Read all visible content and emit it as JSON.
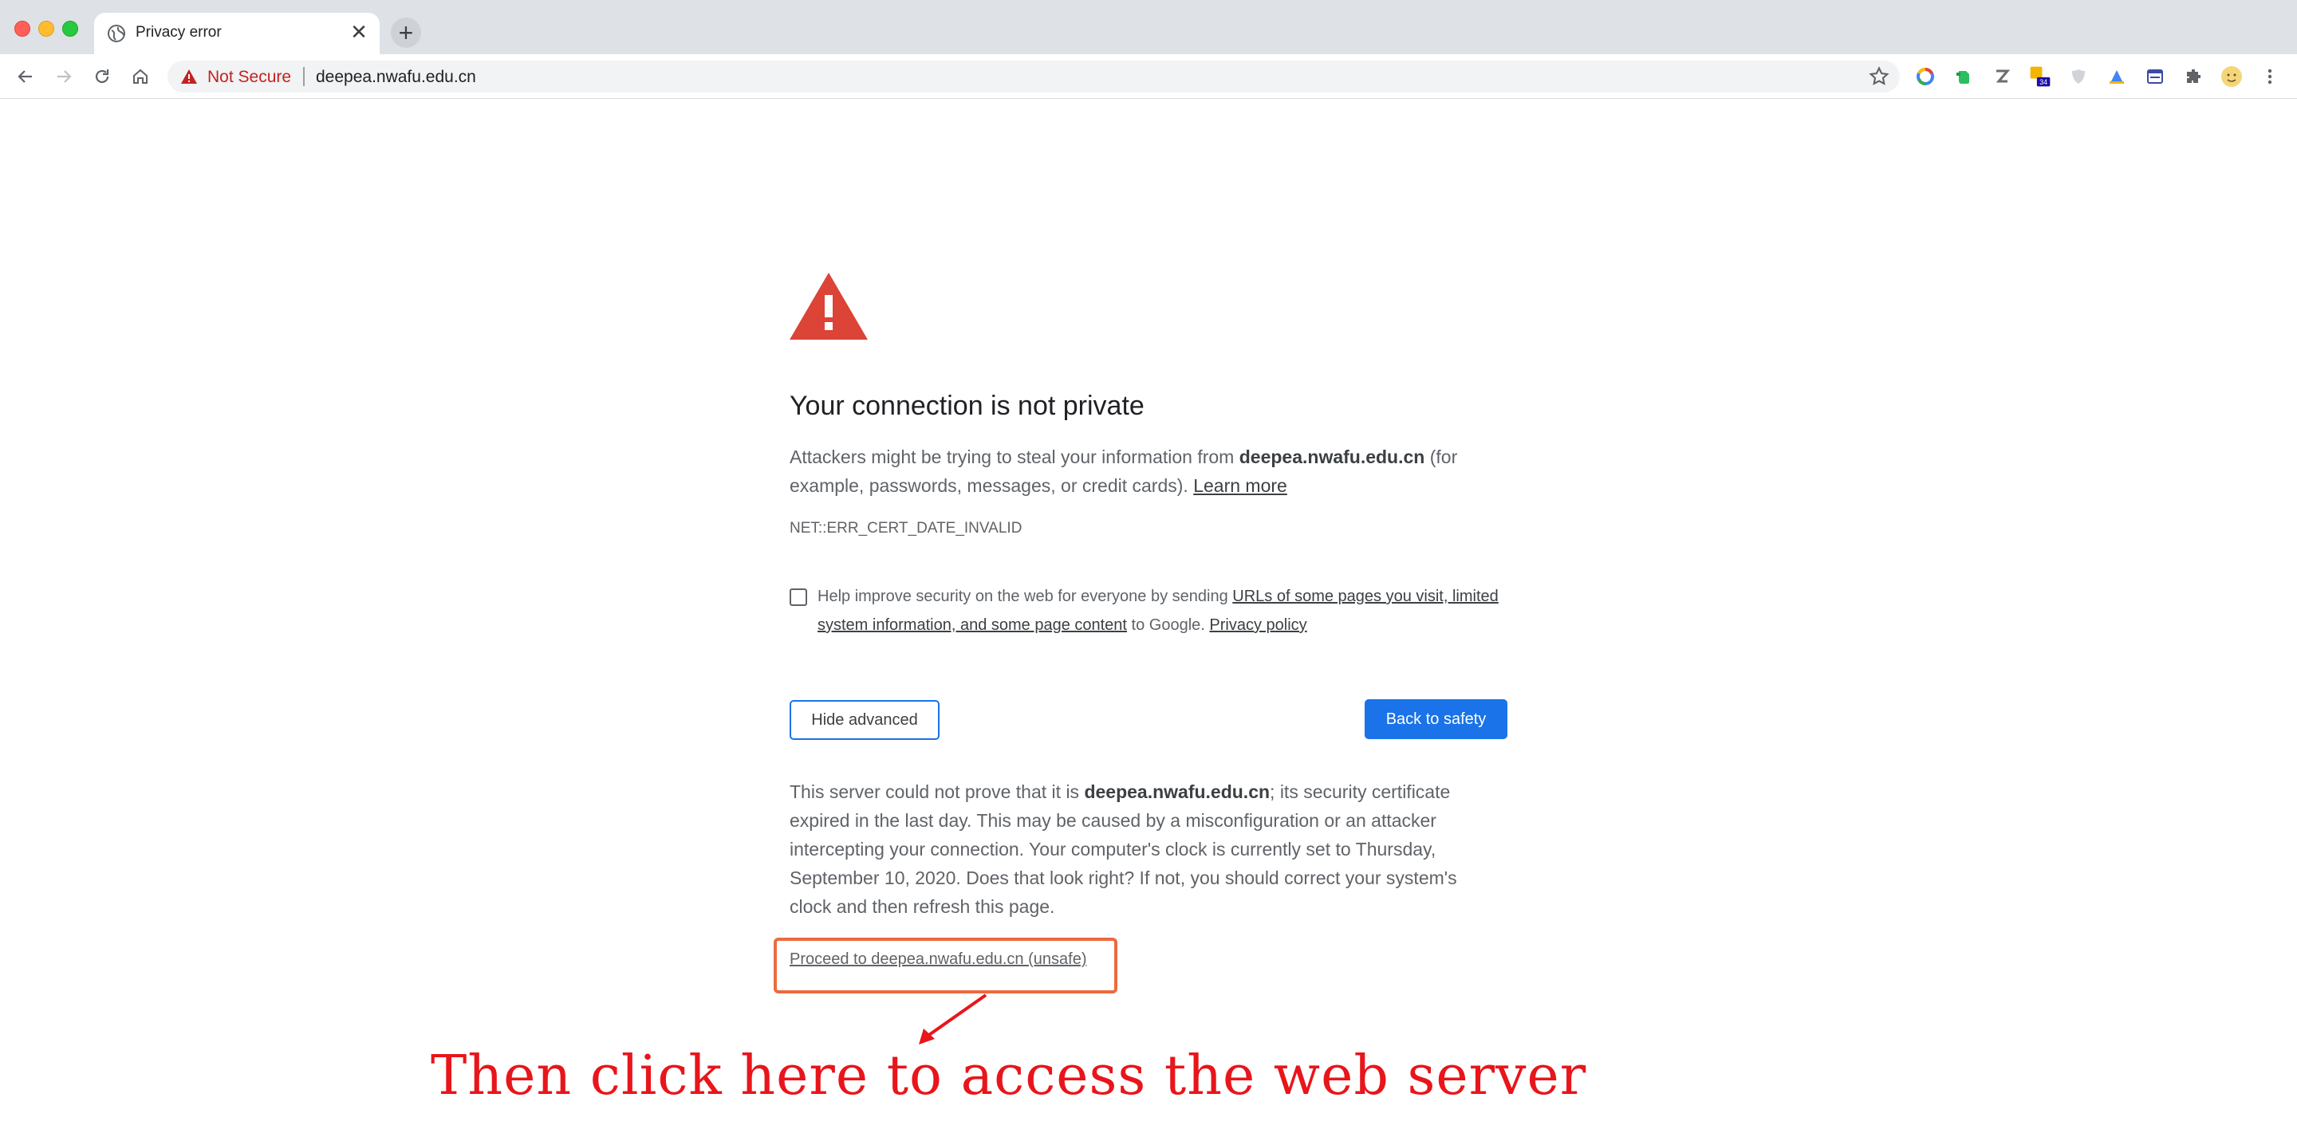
{
  "browser": {
    "tab_title": "Privacy error",
    "tab_close_glyph": "✕",
    "new_tab_glyph": "+",
    "security_label": "Not Secure",
    "url": "deepea.nwafu.edu.cn",
    "extension_badge": "34",
    "icons": [
      "back-icon",
      "forward-icon",
      "reload-icon",
      "home-icon",
      "star-icon",
      "extensions-icon",
      "menu-icon"
    ]
  },
  "page": {
    "heading": "Your connection is not private",
    "intro": {
      "before": "Attackers might be trying to steal your information from ",
      "domain": "deepea.nwafu.edu.cn",
      "after": " (for example, passwords, messages, or credit cards). ",
      "learn_more": "Learn more"
    },
    "error_code": "NET::ERR_CERT_DATE_INVALID",
    "help": {
      "before": "Help improve security on the web for everyone by sending ",
      "link1": "URLs of some pages you visit, limited system information, and some page content",
      "middle": " to Google. ",
      "link2": "Privacy policy",
      "checked": false
    },
    "hide_advanced_label": "Hide advanced",
    "back_to_safety_label": "Back to safety",
    "details": {
      "before": "This server could not prove that it is ",
      "domain": "deepea.nwafu.edu.cn",
      "after": "; its security certificate expired in the last day. This may be caused by a misconfiguration or an attacker intercepting your connection. Your computer's clock is currently set to Thursday, September 10, 2020. Does that look right? If not, you should correct your system's clock and then refresh this page."
    },
    "proceed_link": "Proceed to deepea.nwafu.edu.cn (unsafe)"
  },
  "annotation": {
    "text": "Then click here to access the web server",
    "color": "#e8151b",
    "box_color": "#ec6a3f"
  },
  "colors": {
    "accent": "#1a73e8",
    "warning": "#db4437",
    "insecure": "#c5221f"
  }
}
